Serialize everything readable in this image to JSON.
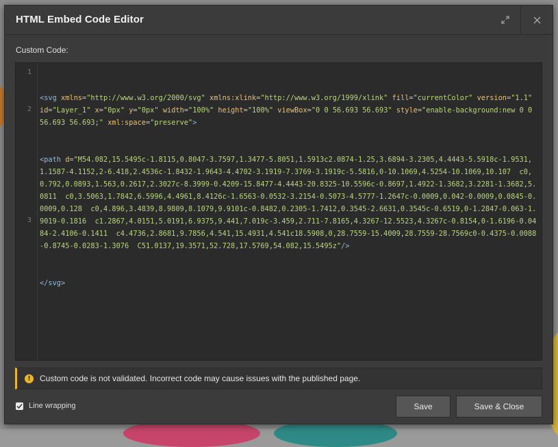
{
  "dialog": {
    "title": "HTML Embed Code Editor",
    "expand_icon": "expand-icon",
    "close_icon": "close-icon"
  },
  "editor": {
    "label": "Custom Code:",
    "line_numbers": [
      "1",
      "2",
      "3"
    ],
    "line1": {
      "open": "<svg",
      "segments": [
        {
          "attr": " xmlns=",
          "val": "\"http://www.w3.org/2000/svg\""
        },
        {
          "attr": " xmlns:xlink=",
          "val": "\"http://www.w3.org/1999/xlink\""
        },
        {
          "attr": " fill=",
          "val": "\"currentColor\""
        },
        {
          "attr": " version=",
          "val": "\"1.1\""
        },
        {
          "attr": " id=",
          "val": "\"Layer_1\""
        },
        {
          "attr": " x=",
          "val": "\"0px\""
        },
        {
          "attr": " y=",
          "val": "\"0px\""
        },
        {
          "attr": " width=",
          "val": "\"100%\""
        },
        {
          "attr": " height=",
          "val": "\"100%\""
        },
        {
          "attr": " viewBox=",
          "val": "\"0 0 56.693 56.693\""
        },
        {
          "attr": " style=",
          "val": "\"enable-background:new 0 0 56.693 56.693;\""
        },
        {
          "attr": " xml:space=",
          "val": "\"preserve\""
        }
      ],
      "close": ">"
    },
    "line2": {
      "open": "<path",
      "attr": " d=",
      "val": "\"M54.082,15.5495c-1.8115,0.8047-3.7597,1.3477-5.8051,1.5913c2.0874-1.25,3.6894-3.2305,4.4443-5.5918c-1.9531,1.1587-4.1152,2-6.418,2.4536c-1.8432-1.9643-4.4702-3.1919-7.3769-3.1919c-5.5816,0-10.1069,4.5254-10.1069,10.107  c0,0.792,0.0893,1.563,0.2617,2.3027c-8.3999-0.4209-15.8477-4.4443-20.8325-10.5596c-0.8697,1.4922-1.3682,3.2281-1.3682,5.0811  c0,3.5063,1.7842,6.5996,4.4961,8.4126c-1.6563-0.0532-3.2154-0.5073-4.5777-1.2647c-0.0009,0.042-0.0009,0.0845-0.0009,0.128  c0,4.896,3.4839,8.9809,8.1079,9.9101c-0.8482,0.2305-1.7412,0.3545-2.6631,0.3545c-0.6519,0-1.2847-0.063-1.9019-0.1816  c1.2867,4.0151,5.0191,6.9375,9.441,7.019c-3.459,2.711-7.8165,4.3267-12.5523,4.3267c-0.8154,0-1.6196-0.0484-2.4106-0.1411  c4.4736,2.8681,9.7856,4.541,15.4931,4.541c18.5908,0,28.7559-15.4009,28.7559-28.7569c0-0.4375-0.0088-0.8745-0.0283-1.3076  C51.0137,19.3571,52.728,17.5769,54.082,15.5495z\"",
      "close": "/>"
    },
    "line3": "</svg>"
  },
  "warning": {
    "icon": "warning-icon",
    "text": "Custom code is not validated. Incorrect code may cause issues with the published page."
  },
  "footer": {
    "line_wrapping_label": "Line wrapping",
    "line_wrapping_checked": true,
    "save_label": "Save",
    "save_close_label": "Save & Close"
  }
}
